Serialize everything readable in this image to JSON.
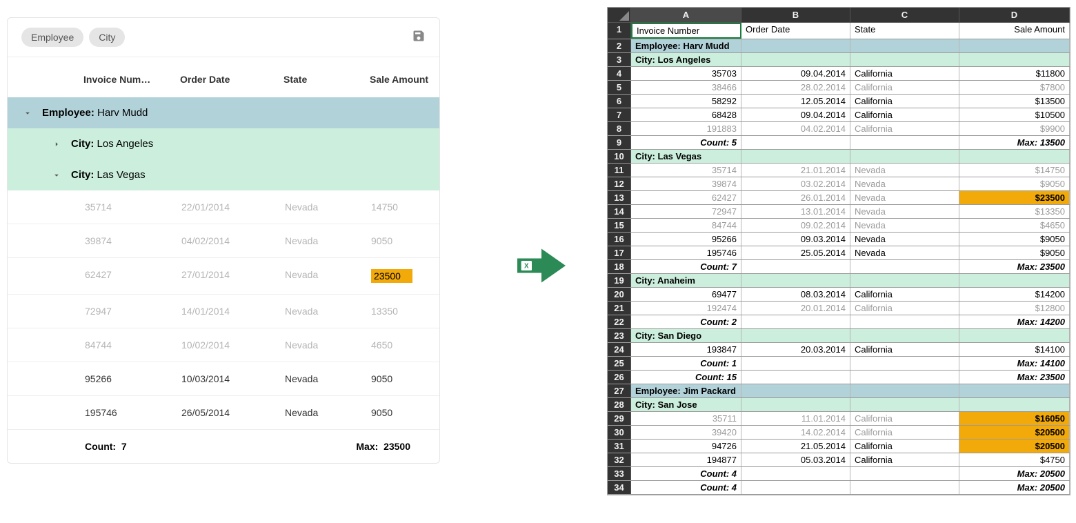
{
  "grid": {
    "chips": [
      "Employee",
      "City"
    ],
    "columns": [
      "Invoice Num…",
      "Order Date",
      "State",
      "Sale Amount"
    ],
    "group_emp_label": "Employee:",
    "group_emp_value": "Harv Mudd",
    "city1_label": "City:",
    "city1_value": "Los Angeles",
    "city2_label": "City:",
    "city2_value": "Las Vegas",
    "rows": [
      {
        "inv": "35714",
        "date": "22/01/2014",
        "state": "Nevada",
        "amt": "14750",
        "dim": true,
        "hi": false
      },
      {
        "inv": "39874",
        "date": "04/02/2014",
        "state": "Nevada",
        "amt": "9050",
        "dim": true,
        "hi": false
      },
      {
        "inv": "62427",
        "date": "27/01/2014",
        "state": "Nevada",
        "amt": "23500",
        "dim": true,
        "hi": true
      },
      {
        "inv": "72947",
        "date": "14/01/2014",
        "state": "Nevada",
        "amt": "13350",
        "dim": true,
        "hi": false
      },
      {
        "inv": "84744",
        "date": "10/02/2014",
        "state": "Nevada",
        "amt": "4650",
        "dim": true,
        "hi": false
      },
      {
        "inv": "95266",
        "date": "10/03/2014",
        "state": "Nevada",
        "amt": "9050",
        "dim": false,
        "hi": false
      },
      {
        "inv": "195746",
        "date": "26/05/2014",
        "state": "Nevada",
        "amt": "9050",
        "dim": false,
        "hi": false
      }
    ],
    "footer_count_label": "Count:",
    "footer_count_value": "7",
    "footer_max_label": "Max:",
    "footer_max_value": "23500"
  },
  "sheet": {
    "col_letters": [
      "A",
      "B",
      "C",
      "D"
    ],
    "rows": [
      {
        "n": "1",
        "type": "head",
        "a": "Invoice Number",
        "b": "Order Date",
        "c": "State",
        "d": "Sale Amount"
      },
      {
        "n": "2",
        "type": "emp",
        "a": "Employee: Harv Mudd"
      },
      {
        "n": "3",
        "type": "city",
        "a": "City: Los Angeles"
      },
      {
        "n": "4",
        "type": "data",
        "a": "35703",
        "b": "09.04.2014",
        "c": "California",
        "d": "$11800"
      },
      {
        "n": "5",
        "type": "data",
        "dim": true,
        "a": "38466",
        "b": "28.02.2014",
        "c": "California",
        "d": "$7800"
      },
      {
        "n": "6",
        "type": "data",
        "a": "58292",
        "b": "12.05.2014",
        "c": "California",
        "d": "$13500"
      },
      {
        "n": "7",
        "type": "data",
        "a": "68428",
        "b": "09.04.2014",
        "c": "California",
        "d": "$10500"
      },
      {
        "n": "8",
        "type": "data",
        "dim": true,
        "a": "191883",
        "b": "04.02.2014",
        "c": "California",
        "d": "$9900"
      },
      {
        "n": "9",
        "type": "sum",
        "a": "Count: 5",
        "d": "Max: 13500"
      },
      {
        "n": "10",
        "type": "city",
        "a": "City: Las Vegas"
      },
      {
        "n": "11",
        "type": "data",
        "dim": true,
        "a": "35714",
        "b": "21.01.2014",
        "c": "Nevada",
        "d": "$14750"
      },
      {
        "n": "12",
        "type": "data",
        "dim": true,
        "a": "39874",
        "b": "03.02.2014",
        "c": "Nevada",
        "d": "$9050"
      },
      {
        "n": "13",
        "type": "data",
        "dim": true,
        "a": "62427",
        "b": "26.01.2014",
        "c": "Nevada",
        "d": "$23500",
        "hi": true
      },
      {
        "n": "14",
        "type": "data",
        "dim": true,
        "a": "72947",
        "b": "13.01.2014",
        "c": "Nevada",
        "d": "$13350"
      },
      {
        "n": "15",
        "type": "data",
        "dim": true,
        "a": "84744",
        "b": "09.02.2014",
        "c": "Nevada",
        "d": "$4650"
      },
      {
        "n": "16",
        "type": "data",
        "a": "95266",
        "b": "09.03.2014",
        "c": "Nevada",
        "d": "$9050"
      },
      {
        "n": "17",
        "type": "data",
        "a": "195746",
        "b": "25.05.2014",
        "c": "Nevada",
        "d": "$9050"
      },
      {
        "n": "18",
        "type": "sum",
        "a": "Count: 7",
        "d": "Max: 23500"
      },
      {
        "n": "19",
        "type": "city",
        "a": "City: Anaheim"
      },
      {
        "n": "20",
        "type": "data",
        "a": "69477",
        "b": "08.03.2014",
        "c": "California",
        "d": "$14200"
      },
      {
        "n": "21",
        "type": "data",
        "dim": true,
        "a": "192474",
        "b": "20.01.2014",
        "c": "California",
        "d": "$12800"
      },
      {
        "n": "22",
        "type": "sum",
        "a": "Count: 2",
        "d": "Max: 14200"
      },
      {
        "n": "23",
        "type": "city",
        "a": "City: San Diego"
      },
      {
        "n": "24",
        "type": "data",
        "a": "193847",
        "b": "20.03.2014",
        "c": "California",
        "d": "$14100"
      },
      {
        "n": "25",
        "type": "sum",
        "a": "Count: 1",
        "d": "Max: 14100"
      },
      {
        "n": "26",
        "type": "sum",
        "a": "Count: 15",
        "d": "Max: 23500"
      },
      {
        "n": "27",
        "type": "emp",
        "a": "Employee: Jim Packard"
      },
      {
        "n": "28",
        "type": "city",
        "a": "City: San Jose"
      },
      {
        "n": "29",
        "type": "data",
        "dim": true,
        "a": "35711",
        "b": "11.01.2014",
        "c": "California",
        "d": "$16050",
        "hi": true
      },
      {
        "n": "30",
        "type": "data",
        "dim": true,
        "a": "39420",
        "b": "14.02.2014",
        "c": "California",
        "d": "$20500",
        "hi": true
      },
      {
        "n": "31",
        "type": "data",
        "a": "94726",
        "b": "21.05.2014",
        "c": "California",
        "d": "$20500",
        "hi": true
      },
      {
        "n": "32",
        "type": "data",
        "a": "194877",
        "b": "05.03.2014",
        "c": "California",
        "d": "$4750"
      },
      {
        "n": "33",
        "type": "sum",
        "a": "Count: 4",
        "d": "Max: 20500"
      },
      {
        "n": "34",
        "type": "sum",
        "a": "Count: 4",
        "d": "Max: 20500"
      }
    ]
  }
}
